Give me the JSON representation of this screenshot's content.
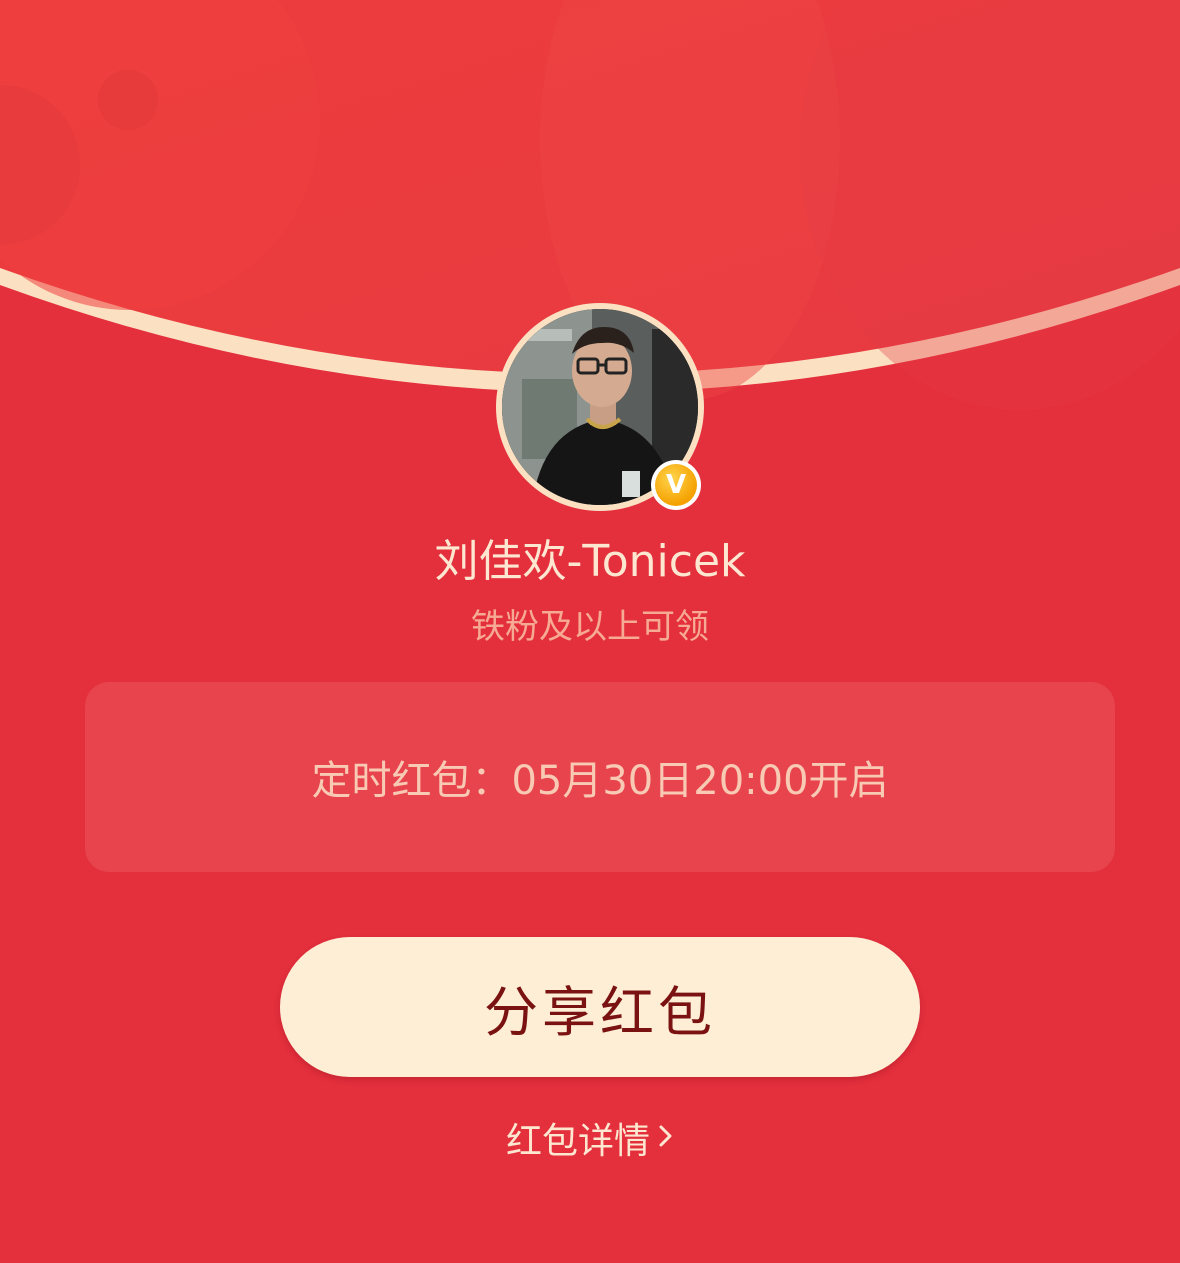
{
  "header": {
    "avatar_alt": "刘佳欢-Tonicek avatar",
    "verified_mark": "V"
  },
  "profile": {
    "username": "刘佳欢-Tonicek",
    "eligibility": "铁粉及以上可领"
  },
  "timer": {
    "text": "定时红包：05月30日20:00开启"
  },
  "actions": {
    "share_label": "分享红包",
    "details_label": "红包详情"
  },
  "colors": {
    "background": "#e42f3d",
    "flap": "#ec3f43",
    "flap_edge": "#fbe0c2",
    "button_bg": "#feeed6",
    "button_text": "#7a1212",
    "badge": "#f5a100"
  },
  "icons": {
    "verified": "verified-v-badge-icon",
    "details_arrow": "chevron-right-icon"
  }
}
